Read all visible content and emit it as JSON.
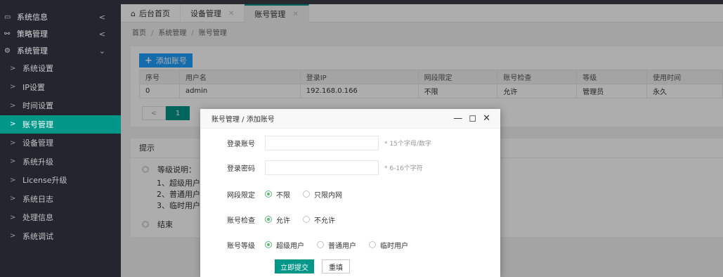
{
  "sidebar": {
    "groups": [
      {
        "icon": "monitor-icon",
        "icon_glyph": "▭",
        "label": "系统信息",
        "arrow": "<"
      },
      {
        "icon": "network-icon",
        "icon_glyph": "⚯",
        "label": "策略管理",
        "arrow": "<"
      },
      {
        "icon": "settings-icon",
        "icon_glyph": "⚙",
        "label": "系统管理",
        "arrow": "⌄"
      }
    ],
    "items": [
      {
        "label": "系统设置",
        "active": false
      },
      {
        "label": "IP设置",
        "active": false
      },
      {
        "label": "时间设置",
        "active": false
      },
      {
        "label": "账号管理",
        "active": true
      },
      {
        "label": "设备管理",
        "active": false
      },
      {
        "label": "系统升级",
        "active": false
      },
      {
        "label": "License升级",
        "active": false
      },
      {
        "label": "系统日志",
        "active": false
      },
      {
        "label": "处理信息",
        "active": false
      },
      {
        "label": "系统调试",
        "active": false
      }
    ],
    "chevron": ">"
  },
  "tabs": [
    {
      "label": "后台首页",
      "icon": "home-icon",
      "glyph": "⌂",
      "closable": false,
      "active": false
    },
    {
      "label": "设备管理",
      "closable": true,
      "active": false
    },
    {
      "label": "账号管理",
      "closable": true,
      "active": true
    }
  ],
  "tab_close": "✕",
  "breadcrumb": [
    "首页",
    "系统管理",
    "账号管理"
  ],
  "breadcrumb_sep": "/",
  "toolbar": {
    "add_label": "添加账号",
    "add_icon": "+"
  },
  "table": {
    "headers": [
      "序号",
      "用户名",
      "登录IP",
      "网段限定",
      "账号检查",
      "等级",
      "使用时间"
    ],
    "rows": [
      [
        "0",
        "admin",
        "192.168.0.166",
        "不限",
        "允许",
        "管理员",
        "永久"
      ]
    ]
  },
  "pager": {
    "prev": "<",
    "current": "1"
  },
  "tips": {
    "title": "提示",
    "level_heading": "等级说明：",
    "level_lines": [
      "1、超级用户",
      "2、普通用户",
      "3、临时用户"
    ],
    "end_label": "结束"
  },
  "dialog": {
    "title": "账号管理 / 添加账号",
    "controls": {
      "minimize": "—",
      "maximize": "◻",
      "close": "✕"
    },
    "fields": {
      "account": {
        "label": "登录账号",
        "value": "",
        "placeholder": "",
        "hint": "* 15个字母/数字"
      },
      "password": {
        "label": "登录密码",
        "value": "",
        "placeholder": "",
        "hint": "* 6-16个字符"
      }
    },
    "segment": {
      "label": "网段限定",
      "options": [
        {
          "label": "不限",
          "checked": true
        },
        {
          "label": "只限内网",
          "checked": false
        }
      ]
    },
    "check": {
      "label": "账号检查",
      "options": [
        {
          "label": "允许",
          "checked": true
        },
        {
          "label": "不允许",
          "checked": false
        }
      ]
    },
    "level": {
      "label": "账号等级",
      "options": [
        {
          "label": "超级用户",
          "checked": true
        },
        {
          "label": "普通用户",
          "checked": false
        },
        {
          "label": "临时用户",
          "checked": false
        }
      ]
    },
    "submit_label": "立即提交",
    "reset_label": "重填"
  },
  "colors": {
    "accent": "#009688",
    "blue": "#1e9fff",
    "sidebar_bg": "#23262e",
    "radio_on": "#5fb878"
  }
}
